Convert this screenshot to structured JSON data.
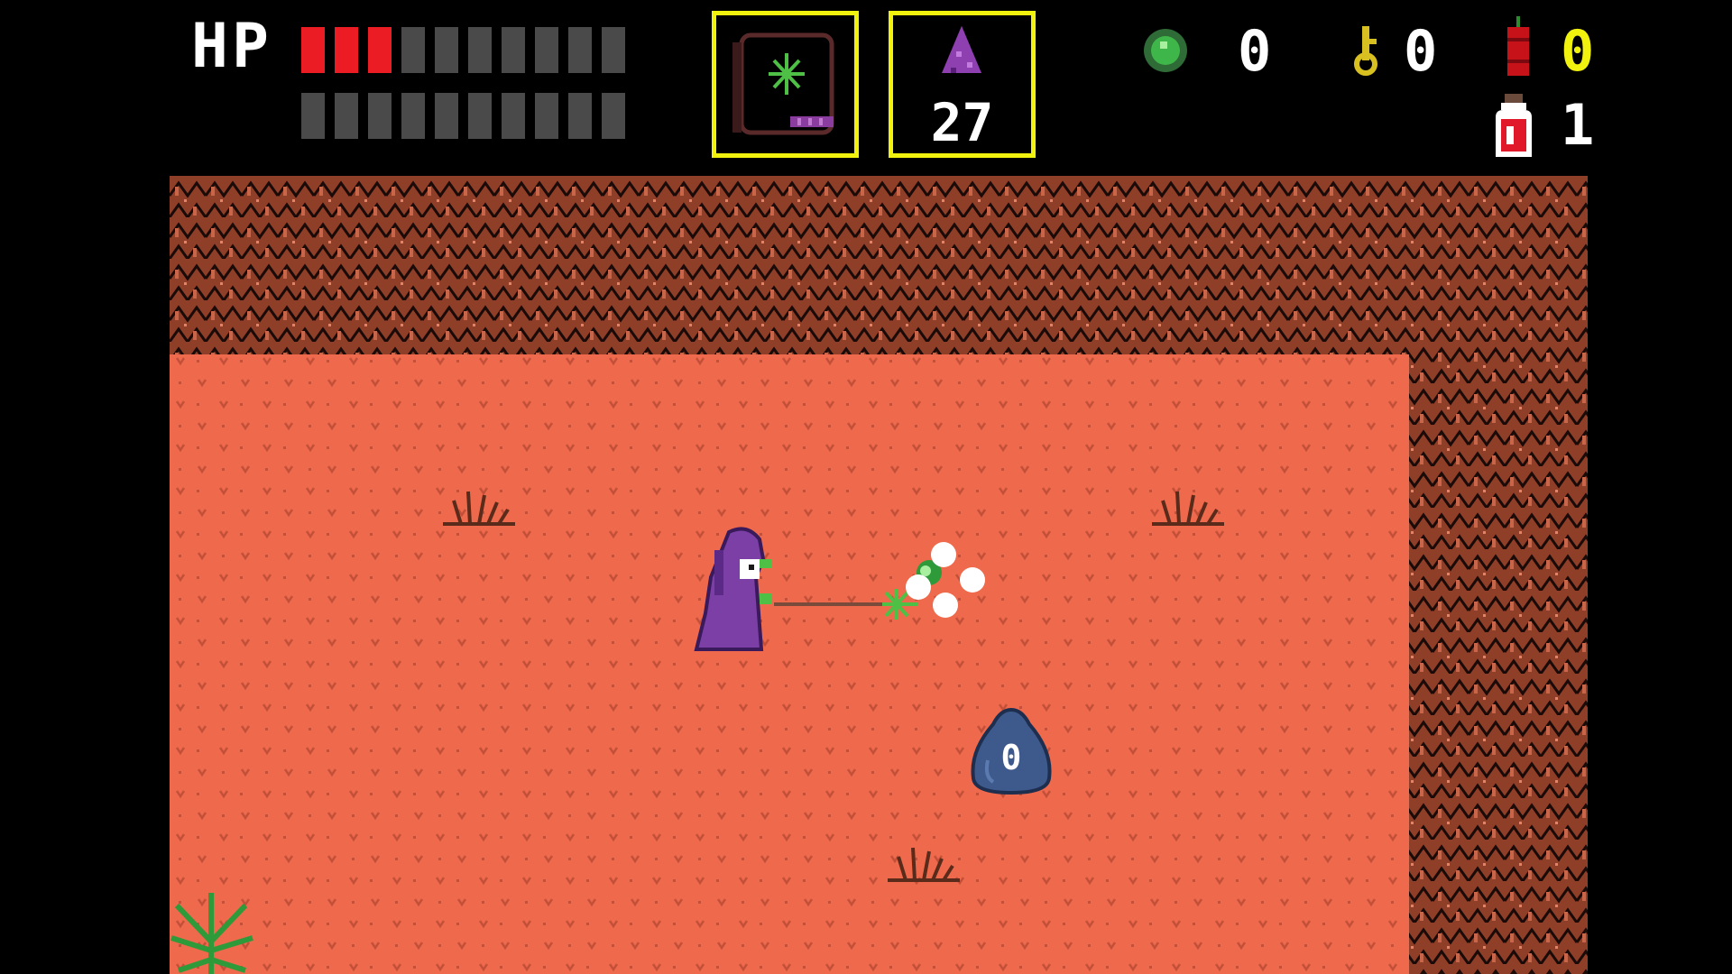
{
  "hud": {
    "hp_label": "HP",
    "hp_current": 3,
    "hp_max": 20,
    "ammo_count": "27",
    "ammo_icon": "purple-crystal-icon",
    "weapon_icon": "green-staff-wand-icon",
    "counters": [
      {
        "icon": "green-gem-icon",
        "value": "0",
        "color": "#ffffff"
      },
      {
        "icon": "key-icon",
        "value": "0",
        "color": "#ffffff"
      },
      {
        "icon": "dynamite-icon",
        "value": "0",
        "color": "#f2f20f"
      },
      {
        "icon": "health-potion-icon",
        "value": "1",
        "color": "#ffffff"
      }
    ]
  },
  "colors": {
    "ground": "#ef6a4c",
    "ground_mark": "#c4503a",
    "rock_wall": "#8f3e28",
    "hp_on": "#ec1c24",
    "hp_off": "#4a4a4a",
    "slot_border": "#f2f20f",
    "wizard": "#7b3fa6",
    "slime": "#3e5a8c"
  },
  "scene": {
    "player": "purple-hooded-wizard",
    "enemy": "blue-slime",
    "enemy_label": "0",
    "projectile": "green-magic-bolt",
    "decor": [
      "dry-bush",
      "dry-bush",
      "dry-bush",
      "green-plant"
    ]
  }
}
